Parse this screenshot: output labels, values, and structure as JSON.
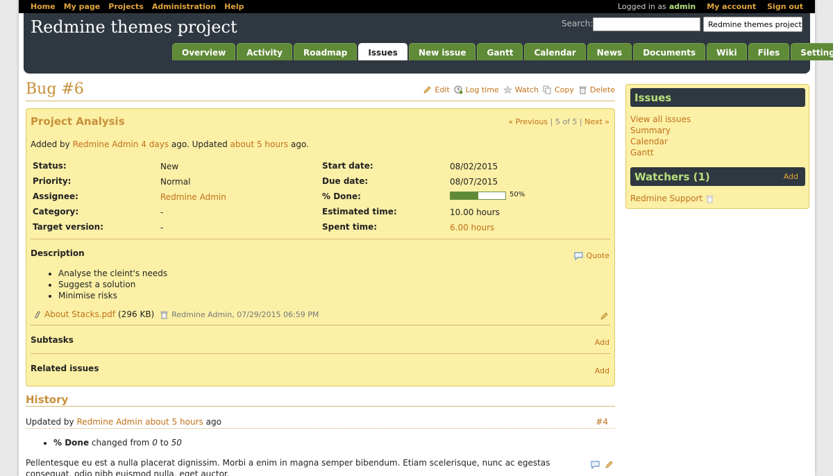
{
  "top_menu": {
    "items": [
      "Home",
      "My page",
      "Projects",
      "Administration",
      "Help"
    ],
    "logged_in_label": "Logged in as",
    "user": "admin",
    "my_account": "My account",
    "sign_out": "Sign out"
  },
  "header": {
    "title": "Redmine themes project",
    "search_label": "Search:",
    "project_jump": "Redmine themes project"
  },
  "tabs": [
    {
      "label": "Overview",
      "selected": false
    },
    {
      "label": "Activity",
      "selected": false
    },
    {
      "label": "Roadmap",
      "selected": false
    },
    {
      "label": "Issues",
      "selected": true
    },
    {
      "label": "New issue",
      "selected": false
    },
    {
      "label": "Gantt",
      "selected": false
    },
    {
      "label": "Calendar",
      "selected": false
    },
    {
      "label": "News",
      "selected": false
    },
    {
      "label": "Documents",
      "selected": false
    },
    {
      "label": "Wiki",
      "selected": false
    },
    {
      "label": "Files",
      "selected": false
    },
    {
      "label": "Settings",
      "selected": false
    }
  ],
  "issue": {
    "title": "Bug #6",
    "actions": {
      "edit": "Edit",
      "log_time": "Log time",
      "watch": "Watch",
      "copy": "Copy",
      "delete": "Delete"
    },
    "subject": "Project Analysis",
    "nav": {
      "previous": "« Previous",
      "position": "5 of 5",
      "next": "Next »"
    },
    "author_prefix": "Added by",
    "author": "Redmine Admin",
    "created": "4 days",
    "updated_prefix": "ago. Updated",
    "updated": "about 5 hours",
    "updated_suffix": "ago.",
    "attributes": {
      "status_label": "Status:",
      "status": "New",
      "priority_label": "Priority:",
      "priority": "Normal",
      "assignee_label": "Assignee:",
      "assignee": "Redmine Admin",
      "category_label": "Category:",
      "category": "-",
      "target_label": "Target version:",
      "target": "-",
      "start_label": "Start date:",
      "start": "08/02/2015",
      "due_label": "Due date:",
      "due": "08/07/2015",
      "done_label": "% Done:",
      "done": "50%",
      "done_value": 0.5,
      "estimated_label": "Estimated time:",
      "estimated": "10.00 hours",
      "spent_label": "Spent time:",
      "spent": "6.00 hours"
    },
    "description_label": "Description",
    "quote": "Quote",
    "description_items": [
      "Analyse the cleint's needs",
      "Suggest a solution",
      "Minimise risks"
    ],
    "attachment": {
      "name": "About Stacks.pdf",
      "size": "(296 KB)",
      "meta": "Redmine Admin, 07/29/2015 06:59 PM"
    },
    "subtasks_label": "Subtasks",
    "related_label": "Related issues",
    "add": "Add"
  },
  "history": {
    "title": "History",
    "updated_by": "Updated by",
    "author": "Redmine Admin",
    "when": "about 5 hours",
    "ago": "ago",
    "number": "#4",
    "detail_field": "% Done",
    "detail_changed": "changed from",
    "detail_from": "0",
    "detail_to_word": "to",
    "detail_to": "50",
    "notes": "Pellentesque eu est a nulla placerat dignissim. Morbi a enim in magna semper bibendum. Etiam scelerisque, nunc ac egestas consequat, odio nibh euismod nulla, eget auctor."
  },
  "sidebar": {
    "issues_title": "Issues",
    "links": [
      "View all issues",
      "Summary",
      "Calendar",
      "Gantt"
    ],
    "watchers_title": "Watchers (1)",
    "watchers_add": "Add",
    "watcher": "Redmine Support"
  },
  "colors": {
    "accent": "#c1711a",
    "header": "#2f3740",
    "tab": "#5f8a38",
    "box": "#fbf0a6"
  }
}
